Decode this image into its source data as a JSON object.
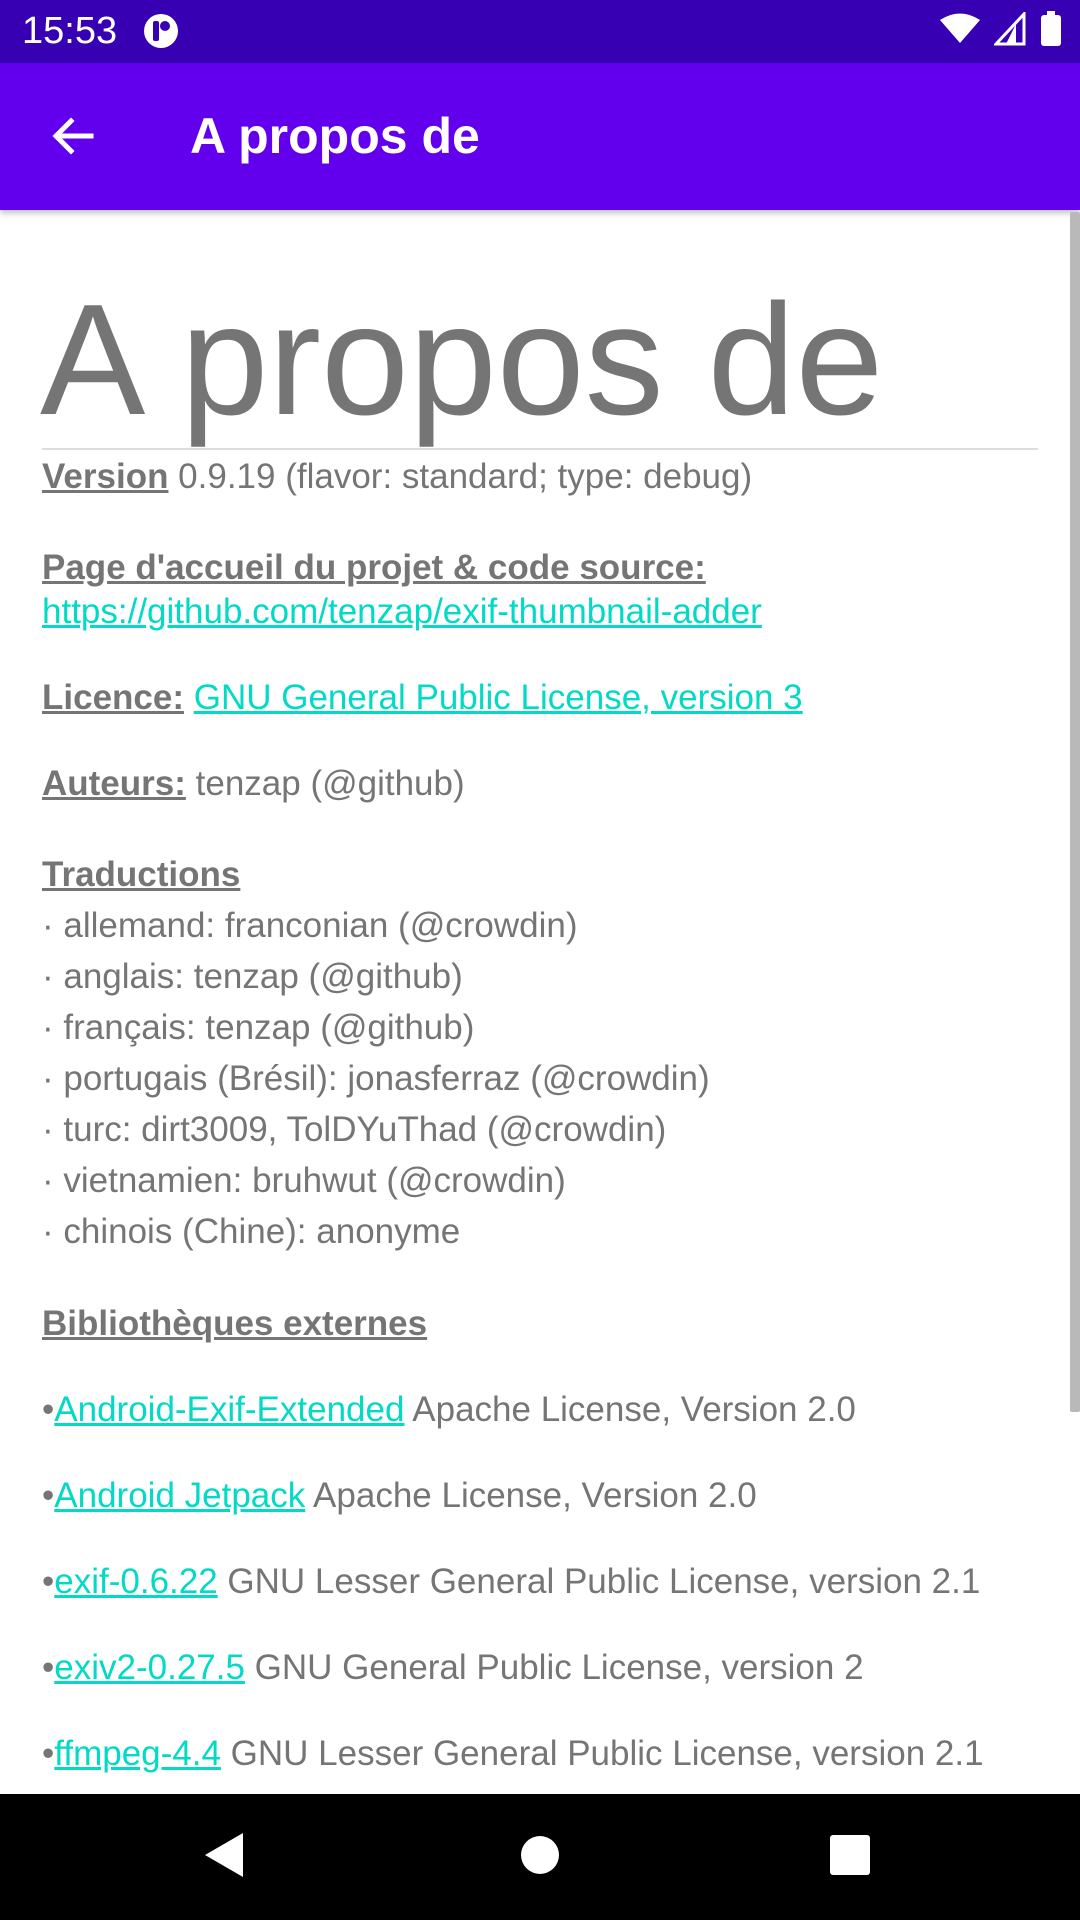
{
  "status_bar": {
    "time": "15:53",
    "notification_icon": "app-notification-icon",
    "icons": [
      "wifi-icon",
      "signal-icon",
      "battery-icon"
    ]
  },
  "app_bar": {
    "back_icon": "arrow-back-icon",
    "title": "A propos de"
  },
  "content": {
    "heading": "A propos de",
    "version": {
      "label": "Version",
      "value": " 0.9.19 (flavor: standard; type: debug)"
    },
    "homepage": {
      "label": "Page d'accueil du projet & code source:",
      "url": "https://github.com/tenzap/exif-thumbnail-adder"
    },
    "license": {
      "label": "Licence:",
      "link": "GNU General Public License, version 3"
    },
    "authors": {
      "label": "Auteurs:",
      "value": " tenzap (@github)"
    },
    "translations": {
      "label": "Traductions",
      "items": [
        "· allemand: franconian (@crowdin)",
        "· anglais: tenzap (@github)",
        "· français: tenzap (@github)",
        "· portugais (Brésil): jonasferraz (@crowdin)",
        "· turc: dirt3009, TolDYuThad (@crowdin)",
        "· vietnamien: bruhwut (@crowdin)",
        "· chinois (Chine): anonyme"
      ]
    },
    "libraries": {
      "label": "Bibliothèques externes",
      "items": [
        {
          "bullet": "•",
          "name": "Android-Exif-Extended",
          "license": " Apache License, Version 2.0"
        },
        {
          "bullet": "•",
          "name": "Android Jetpack",
          "license": " Apache License, Version 2.0"
        },
        {
          "bullet": "•",
          "name": "exif-0.6.22",
          "license": " GNU Lesser General Public License, version 2.1"
        },
        {
          "bullet": "•",
          "name": "exiv2-0.27.5",
          "license": " GNU General Public License, version 2"
        },
        {
          "bullet": "•",
          "name": "ffmpeg-4.4",
          "license": " GNU Lesser General Public License, version 2.1"
        }
      ]
    }
  },
  "nav_bar": {
    "back": "nav-back-icon",
    "home": "nav-home-icon",
    "recents": "nav-recents-icon"
  },
  "colors": {
    "status_bar": "#3700b3",
    "app_bar": "#6200ee",
    "link": "#03dac5",
    "text": "#757575"
  }
}
